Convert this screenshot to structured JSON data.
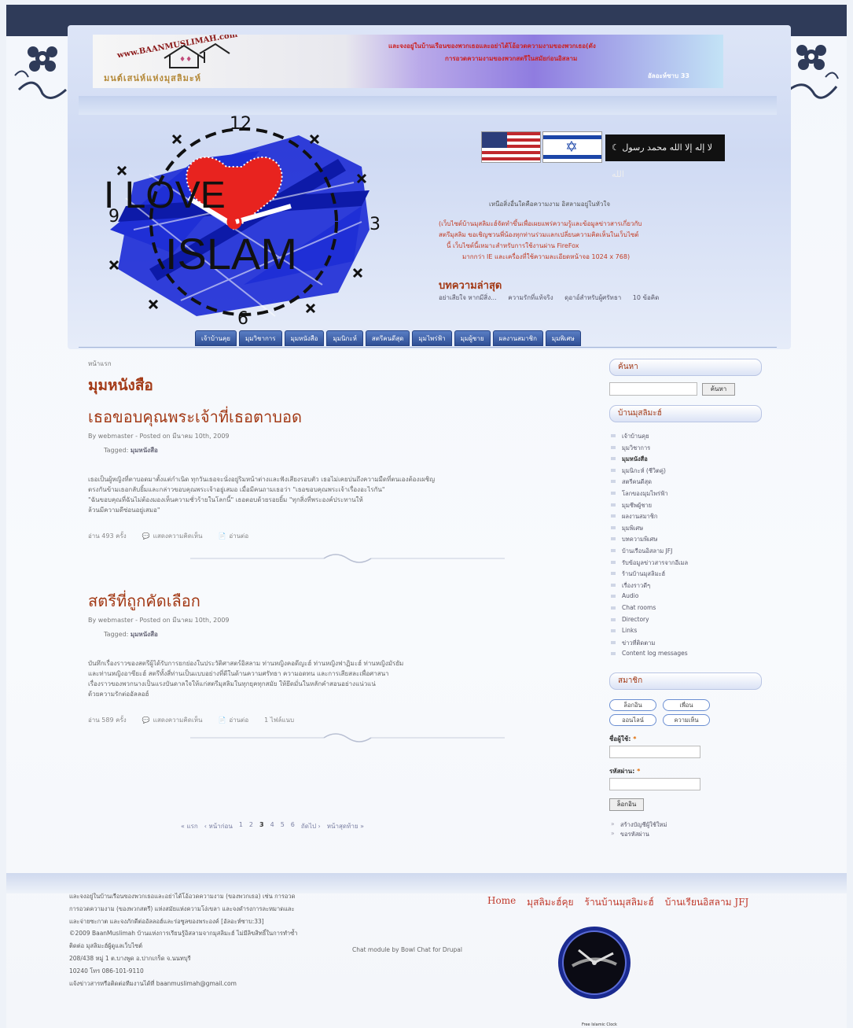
{
  "banner": {
    "site_url": "www.BAANMUSLIMAH.com",
    "site_tagline": "มนต์เสน่ห์แห่งมุสลิมะห์",
    "line1": "และจงอยู่ในบ้านเรือนของพวกเธอและอย่าได้โอ้อวดความงามของพวกเธอ(ดัง",
    "line2": "การอวดความงามของพวกสตรีในสมัยก่อนอิสลาม",
    "verse": "อัลอะห์ซาบ 33"
  },
  "logo": {
    "text_top": "I LOVE",
    "text_bottom": "ISLAM",
    "numeral_12": "12",
    "numeral_3": "3",
    "numeral_6": "6",
    "numeral_9": "9"
  },
  "flags": {
    "shahada": "لا إله إلا الله محمد رسول الله"
  },
  "header": {
    "quote": "เหนือสิ่งอื่นใดคือความงาม อิสลามอยู่ในหัวใจ",
    "notice": [
      "(เว็บไซต์บ้านมุสลิมะฮ์จัดทำขึ้นเพื่อเผยแพร่ความรู้และข้อมูลข่าวสารเกี่ยวกับ",
      "สตรีมุสลิม ขอเชิญชวนพี่น้องทุกท่านร่วมแลกเปลี่ยนความคิดเห็นในเว็บไซต์",
      "นี้ เว็บไซต์นี้เหมาะสำหรับการใช้งานผ่าน FireFox",
      "มากกว่า IE และเครื่องที่ใช้ความละเอียดหน้าจอ 1024 x 768)"
    ],
    "latest_title": "บทความล่าสุด",
    "latest_items": [
      "อย่าเสียใจ หากมีสิ่ง...",
      "ความรักที่แท้จริง",
      "ดุอาอ์สำหรับผู้ศรัทธา",
      "10 ข้อคิด"
    ]
  },
  "nav": [
    "เจ้าบ้านคุย",
    "มุมวิชาการ",
    "มุมหนังสือ",
    "มุมนิกะห์",
    "สตรีคนดีสุด",
    "มุมไพร่ฟ้า",
    "มุมผู้ชาย",
    "ผลงานสมาชิก",
    "มุมพิเศษ"
  ],
  "main": {
    "crumb": "หน้าแรก",
    "section_title": "มุมหนังสือ",
    "posts": [
      {
        "title": "เธอขอบคุณพระเจ้าที่เธอตาบอด",
        "meta": "By webmaster - Posted on มีนาคม 10th, 2009",
        "tags_label": "Tagged:",
        "tag": "มุมหนังสือ",
        "body": [
          "เธอเป็นผู้หญิงที่ตาบอดมาตั้งแต่กำเนิด ทุกวันเธอจะนั่งอยู่ริมหน้าต่างและฟังเสียงรอบตัว เธอไม่เคยบ่นถึงความมืดที่ตนเองต้องเผชิญ",
          "ตรงกันข้ามเธอกลับยิ้มและกล่าวขอบคุณพระเจ้าอยู่เสมอ เมื่อมีคนถามเธอว่า \"เธอขอบคุณพระเจ้าเรื่องอะไรกัน\"",
          "\"ฉันขอบคุณที่ฉันไม่ต้องมองเห็นความชั่วร้ายในโลกนี้\" เธอตอบด้วยรอยยิ้ม \"ทุกสิ่งที่พระองค์ประทานให้",
          "ล้วนมีความดีซ่อนอยู่เสมอ\""
        ],
        "reads": "อ่าน 493 ครั้ง",
        "comment_label": "แสดงความคิดเห็น",
        "more_label": "อ่านต่อ",
        "comments": ""
      },
      {
        "title": "สตรีที่ถูกคัดเลือก",
        "meta": "By webmaster - Posted on มีนาคม 10th, 2009",
        "tags_label": "Tagged:",
        "tag": "มุมหนังสือ",
        "body": [
          "บันทึกเรื่องราวของสตรีผู้ได้รับการยกย่องในประวัติศาสตร์อิสลาม ท่านหญิงคอดีญะฮ์ ท่านหญิงฟาฏิมะฮ์ ท่านหญิงมัรยัม",
          "และท่านหญิงอาซียะฮ์ สตรีทั้งสี่ท่านเป็นแบบอย่างที่ดีในด้านความศรัทธา ความอดทน และการเสียสละเพื่อศาสนา",
          "เรื่องราวของพวกนางเป็นแรงบันดาลใจให้แก่สตรีมุสลิมในทุกยุคทุกสมัย ให้ยึดมั่นในหลักคำสอนอย่างแน่วแน่",
          "ด้วยความรักต่ออัลลอฮ์"
        ],
        "reads": "อ่าน 589 ครั้ง",
        "comment_label": "แสดงความคิดเห็น",
        "more_label": "อ่านต่อ",
        "comments": "1 ไฟล์แนบ"
      }
    ]
  },
  "pager": {
    "first": "« แรก",
    "prev": "‹ หน้าก่อน",
    "pages": [
      "1",
      "2",
      "3",
      "4",
      "5",
      "6"
    ],
    "current": "3",
    "next": "ถัดไป ›",
    "last": "หน้าสุดท้าย »"
  },
  "sidebar": {
    "search_title": "ค้นหา",
    "search_button": "ค้นหา",
    "menu_title": "บ้านมุสลิมะฮ์",
    "menu_items": [
      "เจ้าบ้านคุย",
      "มุมวิชาการ",
      "มุมหนังสือ",
      "มุมนิกะห์ (ชีวิตคู่)",
      "สตรีคนดีสุด",
      "โลกของมุมไพร่ฟ้า",
      "มุมชีพผู้ชาย",
      "ผลงานสมาชิก",
      "มุมพิเศษ",
      "บทความพิเศษ",
      "บ้านเรือนอิสลาม JFJ",
      "รับข้อมูลข่าวสารจากอีเมล",
      "ร้านบ้านมุสลิมะฮ์",
      "เรื่องราวดีๆ",
      "Audio",
      "Chat rooms",
      "Directory",
      "Links",
      "ข่าวที่ติดตาม",
      "Content log messages"
    ],
    "active_index": 2,
    "member_title": "สมาชิก",
    "tabs": [
      "ล็อกอิน",
      "เพื่อน",
      "ออนไลน์",
      "ความเห็น"
    ],
    "username_label": "ชื่อผู้ใช้:",
    "password_label": "รหัสผ่าน:",
    "required_mark": "*",
    "login_button": "ล็อกอิน",
    "links": [
      "สร้างบัญชีผู้ใช้ใหม่",
      "ขอรหัสผ่าน"
    ]
  },
  "footer": {
    "text": [
      "และจงอยู่ในบ้านเรือนของพวกเธอและอย่าได้โอ้อวดความงาม (ของพวกเธอ) เช่น การอวด",
      "การอวดความงาม (ของพวกสตรี) แห่งสมัยแห่งความโง่เขลา และจงดำรงการละหมาดและ",
      "และจ่ายซะกาต และจงภักดีต่ออัลลอฮ์และร่อซูลของพระองค์ [อัลอะห์ซาบ:33]",
      "©2009 BaanMuslimah บ้านแห่งการเรียนรู้อิสลามจากมุสลิมะฮ์ ไม่มีลิขสิทธิ์ในการทำซ้ำ",
      "ติดต่อ มุสลิมะฮ์ผู้ดูแลเว็บไซต์",
      "208/438 หมู่ 1 ต.บางพูด อ.ปากเกร็ด จ.นนทบุรี",
      "10240 โทร 086-101-9110",
      "แจ้งข่าวสารหรือติดต่อทีมงานได้ที่ baanmuslimah@gmail.com"
    ],
    "links": [
      "Home",
      "มุสลิมะฮ์คุย",
      "ร้านบ้านมุสลิมะฮ์",
      "บ้านเรียนอิสลาม JFJ"
    ],
    "chat_credit": "Chat module by Bowl Chat for Drupal",
    "clock_caption": "Free Islamic Clock"
  },
  "colors": {
    "accent": "#a33a16",
    "nav": "#2f4f95",
    "top_bar": "#2f3b59"
  }
}
